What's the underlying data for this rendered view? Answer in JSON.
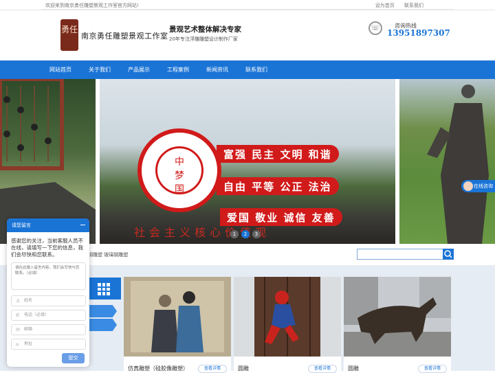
{
  "topbar": {
    "welcome": "欢迎来到南京勇任雕塑景观工作室官方网站!",
    "set_home": "设为首页",
    "contact": "联系我们"
  },
  "header": {
    "seal_text": "勇任",
    "company_name": "南京勇任雕塑景观工作室",
    "slogan_main": "景观艺术整体解决专家",
    "slogan_sub": "20年专注浮雕雕塑设计制作厂家",
    "hotline_label": "咨询热线",
    "hotline_number": "13951897307"
  },
  "nav": {
    "items": [
      "网站首页",
      "关于我们",
      "产品展示",
      "工程案例",
      "新闻资讯",
      "联系我们"
    ]
  },
  "banner": {
    "badge_lines": [
      "中",
      "梦",
      "国"
    ],
    "sign_lines": [
      "富强 民主 文明 和谐",
      "自由 平等 公正 法治",
      "爱国 敬业 诚信 友善"
    ],
    "base_text": "社会主义核心价值观",
    "dots": [
      "1",
      "2",
      "3"
    ],
    "active_dot": 1
  },
  "side_widget": {
    "label": "在线咨询"
  },
  "search": {
    "hot_text": "钢雕塑   玻璃钢雕塑",
    "placeholder": ""
  },
  "products": [
    {
      "title": "仿真雕塑（硅胶像雕塑）",
      "more": "查看详情"
    },
    {
      "title": "圆雕",
      "more": "查看详情"
    },
    {
      "title": "圆雕",
      "more": "查看详情"
    }
  ],
  "chat": {
    "title": "请您留言",
    "message": "感谢您的关注，当前客服人员不在线，请填写一下您的信息，我们会尽快和您联系。",
    "textarea_placeholder": "请在此输入留言内容，我们会尽快与您联系。（必填）",
    "name_placeholder": "姓名",
    "phone_placeholder": "电话（必填）",
    "email_placeholder": "邮箱",
    "address_placeholder": "地址",
    "submit": "提交"
  },
  "colors": {
    "brand_blue": "#1a74d6",
    "sign_red": "#d11a1a",
    "content_bg": "#e6ecf3"
  }
}
